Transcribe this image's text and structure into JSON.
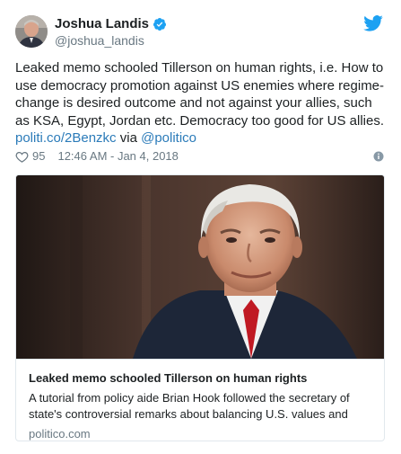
{
  "author": {
    "name": "Joshua Landis",
    "handle": "@joshua_landis",
    "verified": true
  },
  "tweet": {
    "text": "Leaked memo schooled Tillerson on human rights, i.e. How to use democracy promotion against US enemies where regime-change is desired outcome and not against your allies, such as KSA, Egypt, Jordan etc. Democracy too good for US allies.",
    "link": "politi.co/2Benzkc",
    "via": "via",
    "mention": "@politico"
  },
  "meta": {
    "likes": "95",
    "timestamp": "12:46 AM - Jan 4, 2018"
  },
  "card": {
    "title": "Leaked memo schooled Tillerson on human rights",
    "description": "A tutorial from policy aide Brian Hook followed the secretary of state's controversial remarks about balancing U.S. values and",
    "domain": "politico.com"
  },
  "icons": {
    "verified": "verified-badge-icon",
    "brand": "twitter-bird-icon",
    "like": "heart-icon",
    "info": "info-icon"
  },
  "colors": {
    "link": "#2b7bb9",
    "verified": "#1da1f2",
    "twitter": "#1da1f2",
    "muted": "#697882",
    "text": "#1c2022",
    "border": "#e1e8ed"
  }
}
